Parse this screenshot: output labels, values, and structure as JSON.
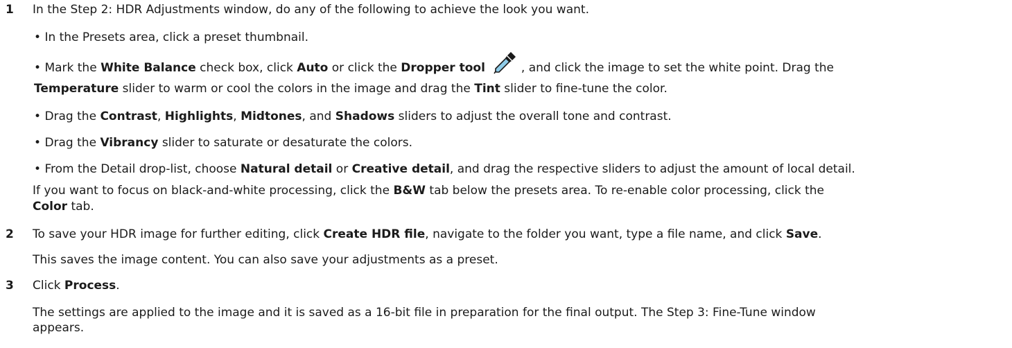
{
  "steps": [
    {
      "number": "1",
      "intro": "In the Step 2: HDR Adjustments window, do any of the following to achieve the look you want.",
      "bullets": {
        "presets": {
          "text": "In the Presets area, click a preset thumbnail."
        },
        "white_balance": {
          "p1": "Mark the ",
          "b1": "White Balance",
          "p2": " check box, click ",
          "b2": "Auto",
          "p3": " or click the ",
          "b3": "Dropper tool",
          "p4": ", and click the image to set the white point. Drag the",
          "b4": "Temperature",
          "p5": " slider to warm or cool the colors in the image and drag the ",
          "b5": "Tint",
          "p6": " slider to fine-tune the color."
        },
        "tone": {
          "p1": "Drag the ",
          "b1": "Contrast",
          "p2": ", ",
          "b2": "Highlights",
          "p3": ", ",
          "b3": "Midtones",
          "p4": ", and ",
          "b4": "Shadows",
          "p5": " sliders to adjust the overall tone and contrast."
        },
        "vibrancy": {
          "p1": "Drag the ",
          "b1": "Vibrancy",
          "p2": " slider to saturate or desaturate the colors."
        },
        "detail": {
          "p1": "From the Detail drop-list, choose ",
          "b1": "Natural detail",
          "p2": " or ",
          "b2": "Creative detail",
          "p3": ", and drag the respective sliders to adjust the amount of local detail."
        }
      },
      "bw_note": {
        "p1": "If you want to focus on black-and-white processing, click the ",
        "b1": "B&W",
        "p2": " tab below the presets area. To re-enable color processing, click the",
        "b2": "Color",
        "p3": " tab."
      }
    },
    {
      "number": "2",
      "p1": "To save your HDR image for further editing, click ",
      "b1": "Create HDR file",
      "p2": ", navigate to the folder you want, type a file name, and click ",
      "b2": "Save",
      "p3": ".",
      "note": "This saves the image content. You can also save your adjustments as a preset."
    },
    {
      "number": "3",
      "p1": "Click ",
      "b1": "Process",
      "p2": ".",
      "result_line1": "The settings are applied to the image and it is saved as a 16-bit file in preparation for the final output. The Step 3: Fine-Tune window",
      "result_line2": "appears."
    }
  ],
  "icons": {
    "dropper": "dropper-tool-icon"
  },
  "colors": {
    "text": "#1b1b1b",
    "dropper_fill": "#8ecbe8",
    "dropper_outline": "#1a1a1a"
  }
}
